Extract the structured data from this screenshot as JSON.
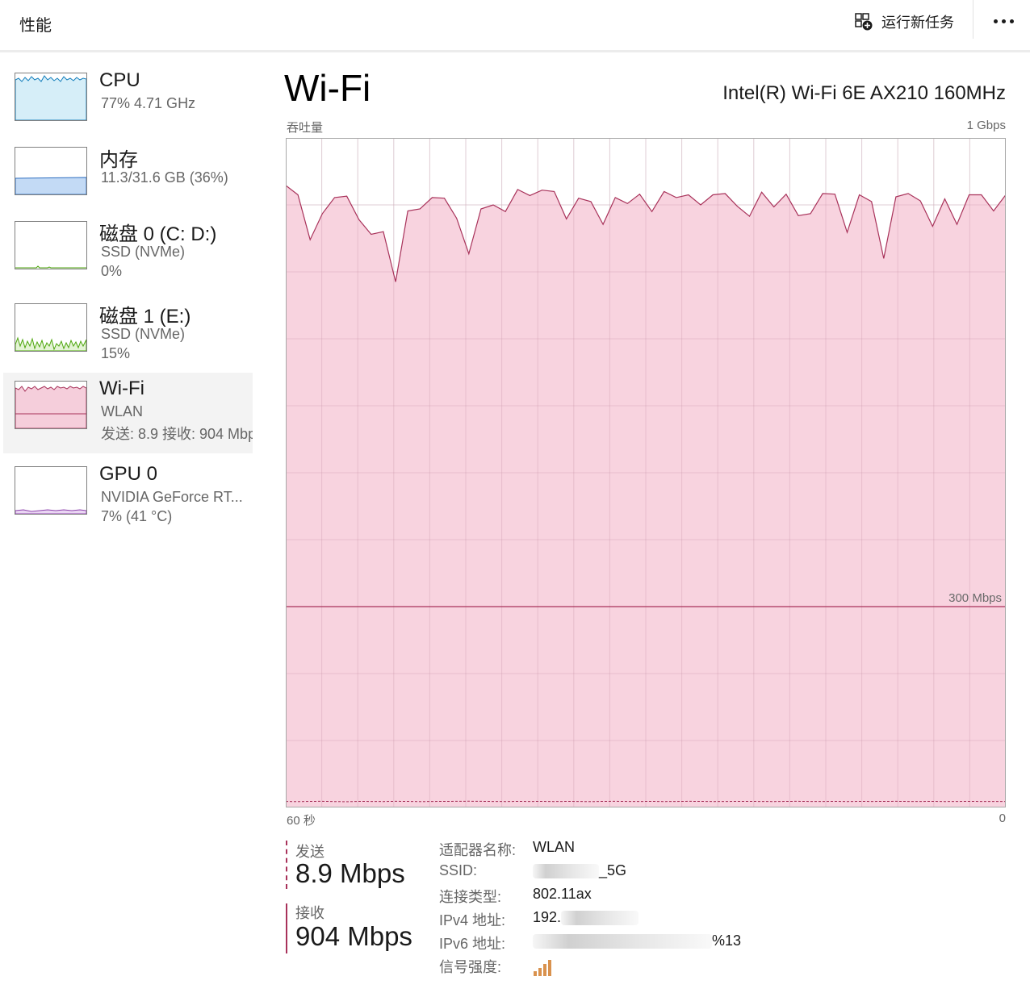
{
  "header": {
    "title": "性能",
    "run_task_label": "运行新任务"
  },
  "sidebar": {
    "items": [
      {
        "name": "CPU",
        "line1": "77%  4.71 GHz",
        "line2": "",
        "color": "#117dbb",
        "fill": "#d6eef8"
      },
      {
        "name": "内存",
        "line1": "11.3/31.6 GB (36%)",
        "line2": "",
        "color": "#2f6fc1",
        "fill": "#c3daf5"
      },
      {
        "name": "磁盘 0 (C: D:)",
        "line1": "SSD (NVMe)",
        "line2": "0%",
        "color": "#4da60c",
        "fill": "#eff7e6"
      },
      {
        "name": "磁盘 1 (E:)",
        "line1": "SSD (NVMe)",
        "line2": "15%",
        "color": "#4da60c",
        "fill": "#e4f4d5"
      },
      {
        "name": "Wi-Fi",
        "line1": "WLAN",
        "line2": "发送: 8.9 接收: 904 Mbps",
        "color": "#a8325a",
        "fill": "#f5cedb"
      },
      {
        "name": "GPU 0",
        "line1": "NVIDIA GeForce RT...",
        "line2": "7%  (41 °C)",
        "color": "#8e44ad",
        "fill": "#ead6f3"
      }
    ],
    "selected": "Wi-Fi"
  },
  "main": {
    "title": "Wi-Fi",
    "adapter": "Intel(R) Wi-Fi 6E AX210 160MHz",
    "graph_label": "吞吐量",
    "graph_max": "1 Gbps",
    "graph_scale_line": "300 Mbps",
    "time_left": "60 秒",
    "time_right": "0"
  },
  "stats": {
    "send_label": "发送",
    "send_value": "8.9 Mbps",
    "recv_label": "接收",
    "recv_value": "904 Mbps"
  },
  "properties": {
    "adapter_key": "适配器名称:",
    "adapter_val": "WLAN",
    "ssid_key": "SSID:",
    "ssid_val_visible": "_5G",
    "conn_key": "连接类型:",
    "conn_val": "802.11ax",
    "ipv4_key": "IPv4 地址:",
    "ipv4_val_visible": "192.",
    "ipv6_key": "IPv6 地址:",
    "ipv6_val_visible": "%13",
    "signal_key": "信号强度:",
    "signal_bars": 4
  },
  "chart_data": {
    "type": "area",
    "ylim_mbps": [
      0,
      1000
    ],
    "xlim_seconds": [
      60,
      0
    ],
    "grid": true,
    "series": [
      {
        "name": "接收",
        "color": "#a8325a",
        "fill": "#f8d3df",
        "values": [
          929,
          915,
          848,
          887,
          911,
          913,
          878,
          856,
          860,
          785,
          891,
          894,
          911,
          910,
          880,
          827,
          894,
          900,
          890,
          923,
          914,
          922,
          920,
          879,
          910,
          905,
          871,
          911,
          902,
          916,
          890,
          920,
          911,
          915,
          900,
          915,
          917,
          898,
          883,
          919,
          897,
          916,
          884,
          887,
          917,
          916,
          859,
          915,
          905,
          820,
          912,
          917,
          906,
          868,
          909,
          871,
          915,
          915,
          891,
          915
        ],
        "unit": "Mbps"
      },
      {
        "name": "发送",
        "color": "#a8325a",
        "dashed": true,
        "values": [
          8.9,
          8.7,
          9.0,
          9.2,
          8.8,
          8.6,
          9.0,
          8.9,
          8.8,
          9.1,
          9.0,
          8.7,
          8.9,
          9.0,
          9.1,
          9.3,
          9.2,
          8.9,
          8.8,
          9.0,
          8.9,
          9.0,
          8.8,
          9.0,
          8.9,
          8.7,
          9.0,
          9.1,
          8.9,
          8.9,
          9.0,
          8.8,
          8.9,
          9.1,
          9.0,
          8.8,
          8.9,
          9.0,
          9.0,
          8.9,
          8.8,
          9.0,
          9.1,
          8.9,
          8.9,
          9.0,
          8.8,
          9.0,
          8.9,
          9.0,
          9.1,
          8.9,
          8.9,
          9.0,
          8.8,
          8.9,
          9.0,
          8.9,
          8.9,
          8.9
        ],
        "unit": "Mbps"
      }
    ],
    "reference_line_mbps": 300
  }
}
